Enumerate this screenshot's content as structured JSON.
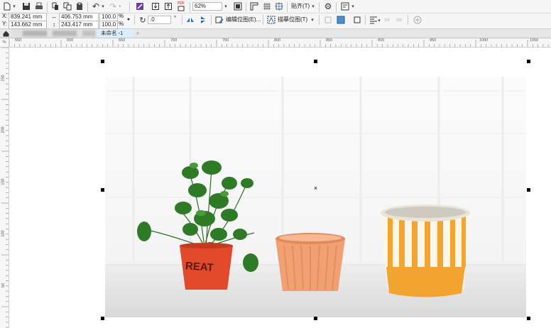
{
  "toolbar": {
    "zoom": "62%",
    "snap_label": "贴齐(T)",
    "pdf_label": "PDF"
  },
  "property_bar": {
    "x_label": "X:",
    "x_value": "839.241 mm",
    "y_label": "Y:",
    "y_value": "143.662 mm",
    "width_value": "406.753 mm",
    "height_value": "243.417 mm",
    "scale_x": "100.0",
    "scale_y": "100.0",
    "percent": "%",
    "rotation_value": ".0",
    "degree_symbol": "°",
    "edit_bitmap_label": "编辑位图(E)...",
    "trace_bitmap_label": "描摹位图(T)"
  },
  "tabs": [
    {
      "label": ""
    },
    {
      "label": "未命名 -1"
    }
  ],
  "ruler": {
    "unit": "%",
    "h_ticks": [
      "550",
      "600",
      "650",
      "700",
      "750",
      "800",
      "850",
      "900",
      "950",
      "1000",
      "1050"
    ],
    "v_ticks": [
      "250",
      "200",
      "150",
      "100",
      "50"
    ]
  },
  "canvas": {
    "photo_text": "REAT"
  },
  "colors": {
    "selected_tab": "#dceefc",
    "pot_red": "#e04a2a",
    "pot_peach": "#f0a072",
    "pot_yellow": "#f2a430"
  }
}
